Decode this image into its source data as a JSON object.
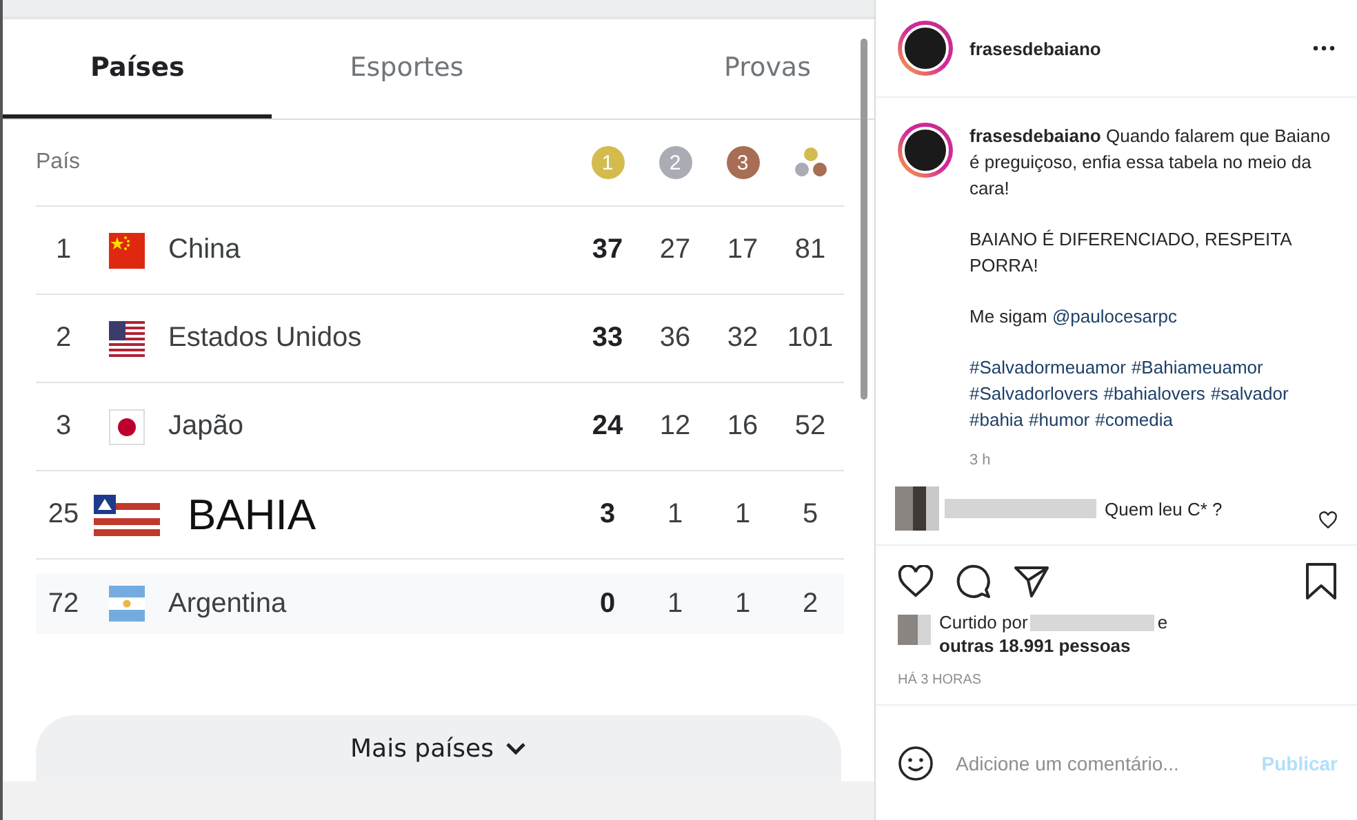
{
  "medal_table": {
    "tabs": [
      {
        "label": "Países",
        "selected": true
      },
      {
        "label": "Esportes",
        "selected": false
      },
      {
        "label": "Provas",
        "selected": false
      }
    ],
    "country_header": "País",
    "medal_headers": [
      {
        "kind": "gold",
        "label": "1"
      },
      {
        "kind": "silver",
        "label": "2"
      },
      {
        "kind": "bronze",
        "label": "3"
      },
      {
        "kind": "total"
      }
    ],
    "rows": [
      {
        "rank": "1",
        "kind": "china",
        "country": "China",
        "highlighted": false,
        "gold": "37",
        "silver": "27",
        "bronze": "17",
        "total": "81"
      },
      {
        "rank": "2",
        "kind": "usa",
        "country": "Estados Unidos",
        "highlighted": false,
        "gold": "33",
        "silver": "36",
        "bronze": "32",
        "total": "101"
      },
      {
        "rank": "3",
        "kind": "japan",
        "country": "Japão",
        "highlighted": false,
        "gold": "24",
        "silver": "12",
        "bronze": "16",
        "total": "52"
      },
      {
        "rank": "25",
        "kind": "bahia",
        "country": "BAHIA",
        "highlighted": false,
        "gold": "3",
        "silver": "1",
        "bronze": "1",
        "total": "5"
      },
      {
        "rank": "72",
        "kind": "argentina",
        "country": "Argentina",
        "highlighted": true,
        "gold": "0",
        "silver": "1",
        "bronze": "1",
        "total": "2"
      }
    ],
    "more_button": "Mais países"
  },
  "post": {
    "author": "frasesdebaiano",
    "caption": {
      "text": "**frasesdebaiano** Quando falarem que Baiano é preguiçoso, enfia essa tabela no meio da cara!",
      "shout": "BAIANO É DIFERENCIADO, RESPEITA PORRA!",
      "follow_text": "Me sigam",
      "mention": "@paulocesarpc",
      "hashtags": [
        "#Salvadormeuamor",
        "#Bahiameuamor",
        "#Salvadorlovers",
        "#bahialovers",
        "#salvador",
        "#bahia",
        "#humor",
        "#comedia"
      ]
    },
    "time": "3 h",
    "comment": {
      "text": "Quem leu C* ?"
    },
    "likes": {
      "prefix": "Curtido por",
      "suffix": "e",
      "count": "outras 18.991 pessoas"
    },
    "timestamp": "HÁ 3 HORAS",
    "comment_field": {
      "placeholder": "Adicione um comentário..."
    },
    "publish": {
      "label": "Publicar",
      "disabled": true
    }
  }
}
